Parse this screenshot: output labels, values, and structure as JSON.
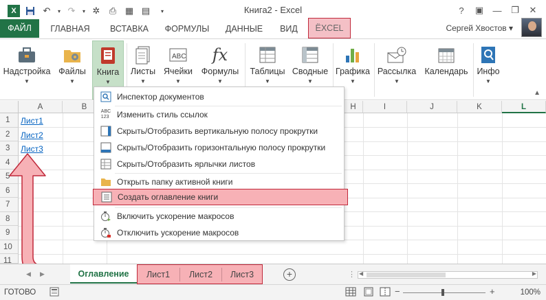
{
  "window": {
    "title": "Книга2 - Excel",
    "user": "Сергей Хвостов"
  },
  "tabs": [
    {
      "label": "ФАЙЛ",
      "name": "tab-file"
    },
    {
      "label": "ГЛАВНАЯ",
      "name": "tab-home"
    },
    {
      "label": "ВСТАВКА",
      "name": "tab-insert"
    },
    {
      "label": "ФОРМУЛЫ",
      "name": "tab-formulas"
    },
    {
      "label": "ДАННЫЕ",
      "name": "tab-data"
    },
    {
      "label": "ВИД",
      "name": "tab-view"
    },
    {
      "label": "ЁXCEL",
      "name": "tab-yoxcel"
    }
  ],
  "ribbon": [
    {
      "label": "Надстройка",
      "name": "ribbon-addins",
      "icon": "toolbox-icon"
    },
    {
      "label": "Файлы",
      "name": "ribbon-files",
      "icon": "folder-gear-icon"
    },
    {
      "label": "Книга",
      "name": "ribbon-book",
      "icon": "workbook-icon"
    },
    {
      "label": "Листы",
      "name": "ribbon-sheets",
      "icon": "sheets-icon"
    },
    {
      "label": "Ячейки",
      "name": "ribbon-cells",
      "icon": "abc-cells-icon"
    },
    {
      "label": "Формулы",
      "name": "ribbon-formulas",
      "icon": "fx-icon"
    },
    {
      "label": "Таблицы",
      "name": "ribbon-tables",
      "icon": "table-icon"
    },
    {
      "label": "Сводные",
      "name": "ribbon-pivots",
      "icon": "pivot-icon"
    },
    {
      "label": "Графика",
      "name": "ribbon-graphics",
      "icon": "bar-chart-icon"
    },
    {
      "label": "Рассылка",
      "name": "ribbon-mailing",
      "icon": "mail-clock-icon"
    },
    {
      "label": "Календарь",
      "name": "ribbon-calendar",
      "icon": "calendar-icon"
    },
    {
      "label": "Инфо",
      "name": "ribbon-info",
      "icon": "info-search-icon"
    }
  ],
  "menu": [
    {
      "label": "Инспектор документов",
      "icon": "inspector-icon"
    },
    {
      "label": "Изменить стиль ссылок",
      "icon": "abc-123-icon"
    },
    {
      "label": "Скрыть/Отобразить вертикальную полосу прокрутки",
      "icon": "vscroll-icon"
    },
    {
      "label": "Скрыть/Отобразить горизонтальную полосу прокрутки",
      "icon": "hscroll-icon"
    },
    {
      "label": "Скрыть/Отобразить ярлычки листов",
      "icon": "sheet-tabs-icon"
    },
    {
      "label": "Открыть папку активной книги",
      "icon": "folder-icon"
    },
    {
      "label": "Создать оглавление книги",
      "icon": "toc-icon"
    },
    {
      "label": "Включить ускорение макросов",
      "icon": "stopwatch-on-icon"
    },
    {
      "label": "Отключить ускорение макросов",
      "icon": "stopwatch-off-icon"
    }
  ],
  "columns": [
    "A",
    "B",
    "H",
    "I",
    "J",
    "K",
    "L"
  ],
  "rows": [
    "1",
    "2",
    "3",
    "4",
    "5",
    "6",
    "7",
    "8",
    "9",
    "10",
    "11"
  ],
  "cells": {
    "a1": "Лист1",
    "a2": "Лист2",
    "a3": "Лист3"
  },
  "sheets": {
    "active": "Оглавление",
    "others": [
      "Лист1",
      "Лист2",
      "Лист3"
    ]
  },
  "status": {
    "ready": "ГОТОВО",
    "zoom": "100%"
  },
  "colors": {
    "excel_green": "#217346",
    "highlight_red": "#c0283a",
    "highlight_fill": "#f7b1b6"
  }
}
